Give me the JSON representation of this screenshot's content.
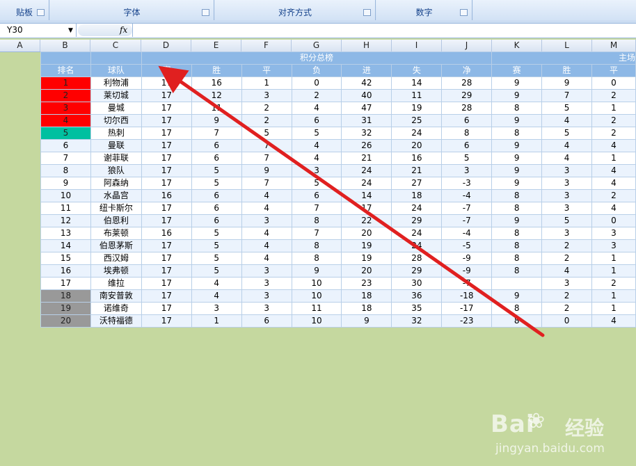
{
  "ribbon": {
    "groups": [
      {
        "label": "贴板"
      },
      {
        "label": "字体"
      },
      {
        "label": "对齐方式"
      },
      {
        "label": "数字"
      }
    ]
  },
  "formula_bar": {
    "name_box": "Y30",
    "fx_label": "fx",
    "formula": ""
  },
  "column_headers": [
    "A",
    "B",
    "C",
    "D",
    "E",
    "F",
    "G",
    "H",
    "I",
    "J",
    "K",
    "L",
    "M"
  ],
  "sheet": {
    "section_title": "积分总榜",
    "section_title_right": "主场",
    "headers": [
      "排名",
      "球队",
      "赛",
      "胜",
      "平",
      "负",
      "进",
      "失",
      "净",
      "赛",
      "胜",
      "平"
    ],
    "rows": [
      {
        "rank": "1",
        "team": "利物浦",
        "cells": [
          "17",
          "16",
          "1",
          "0",
          "42",
          "14",
          "28",
          "9",
          "9",
          "0"
        ],
        "mark": "red"
      },
      {
        "rank": "2",
        "team": "莱切城",
        "cells": [
          "17",
          "12",
          "3",
          "2",
          "40",
          "11",
          "29",
          "9",
          "7",
          "2"
        ],
        "mark": "red"
      },
      {
        "rank": "3",
        "team": "曼城",
        "cells": [
          "17",
          "11",
          "2",
          "4",
          "47",
          "19",
          "28",
          "8",
          "5",
          "1"
        ],
        "mark": "red"
      },
      {
        "rank": "4",
        "team": "切尔西",
        "cells": [
          "17",
          "9",
          "2",
          "6",
          "31",
          "25",
          "6",
          "9",
          "4",
          "2"
        ],
        "mark": "red"
      },
      {
        "rank": "5",
        "team": "热刺",
        "cells": [
          "17",
          "7",
          "5",
          "5",
          "32",
          "24",
          "8",
          "8",
          "5",
          "2"
        ],
        "mark": "teal"
      },
      {
        "rank": "6",
        "team": "曼联",
        "cells": [
          "17",
          "6",
          "7",
          "4",
          "26",
          "20",
          "6",
          "9",
          "4",
          "4"
        ],
        "mark": ""
      },
      {
        "rank": "7",
        "team": "谢菲联",
        "cells": [
          "17",
          "6",
          "7",
          "4",
          "21",
          "16",
          "5",
          "9",
          "4",
          "1"
        ],
        "mark": ""
      },
      {
        "rank": "8",
        "team": "狼队",
        "cells": [
          "17",
          "5",
          "9",
          "3",
          "24",
          "21",
          "3",
          "9",
          "3",
          "4"
        ],
        "mark": ""
      },
      {
        "rank": "9",
        "team": "阿森纳",
        "cells": [
          "17",
          "5",
          "7",
          "5",
          "24",
          "27",
          "-3",
          "9",
          "3",
          "4"
        ],
        "mark": ""
      },
      {
        "rank": "10",
        "team": "水晶宫",
        "cells": [
          "16",
          "6",
          "4",
          "6",
          "14",
          "18",
          "-4",
          "8",
          "3",
          "2"
        ],
        "mark": ""
      },
      {
        "rank": "11",
        "team": "纽卡斯尔",
        "cells": [
          "17",
          "6",
          "4",
          "7",
          "17",
          "24",
          "-7",
          "8",
          "3",
          "4"
        ],
        "mark": ""
      },
      {
        "rank": "12",
        "team": "伯恩利",
        "cells": [
          "17",
          "6",
          "3",
          "8",
          "22",
          "29",
          "-7",
          "9",
          "5",
          "0"
        ],
        "mark": ""
      },
      {
        "rank": "13",
        "team": "布莱顿",
        "cells": [
          "16",
          "5",
          "4",
          "7",
          "20",
          "24",
          "-4",
          "8",
          "3",
          "3"
        ],
        "mark": ""
      },
      {
        "rank": "14",
        "team": "伯恩茅斯",
        "cells": [
          "17",
          "5",
          "4",
          "8",
          "19",
          "24",
          "-5",
          "8",
          "2",
          "3"
        ],
        "mark": ""
      },
      {
        "rank": "15",
        "team": "西汉姆",
        "cells": [
          "17",
          "5",
          "4",
          "8",
          "19",
          "28",
          "-9",
          "8",
          "2",
          "1"
        ],
        "mark": ""
      },
      {
        "rank": "16",
        "team": "埃弗顿",
        "cells": [
          "17",
          "5",
          "3",
          "9",
          "20",
          "29",
          "-9",
          "8",
          "4",
          "1"
        ],
        "mark": ""
      },
      {
        "rank": "17",
        "team": "维拉",
        "cells": [
          "17",
          "4",
          "3",
          "10",
          "23",
          "30",
          "-7",
          "",
          "3",
          "2"
        ],
        "mark": ""
      },
      {
        "rank": "18",
        "team": "南安普敦",
        "cells": [
          "17",
          "4",
          "3",
          "10",
          "18",
          "36",
          "-18",
          "9",
          "2",
          "1"
        ],
        "mark": "gray"
      },
      {
        "rank": "19",
        "team": "诺维奇",
        "cells": [
          "17",
          "3",
          "3",
          "11",
          "18",
          "35",
          "-17",
          "8",
          "2",
          "1"
        ],
        "mark": "gray"
      },
      {
        "rank": "20",
        "team": "沃特福德",
        "cells": [
          "17",
          "1",
          "6",
          "10",
          "9",
          "32",
          "-23",
          "8",
          "0",
          "4"
        ],
        "mark": "gray"
      }
    ]
  },
  "colors": {
    "relegation_gray": "#999999",
    "champions_red": "#ff0000",
    "europa_teal": "#00c0a0",
    "header_blue": "#8db8e6",
    "annotation_arrow": "#e02020"
  },
  "watermark": {
    "brand": "Bai",
    "brand_cn": "经验",
    "url": "jingyan.baidu.com"
  }
}
